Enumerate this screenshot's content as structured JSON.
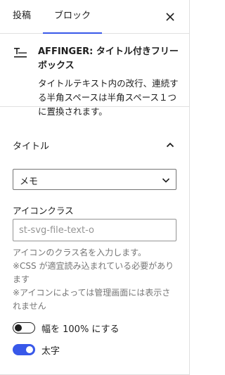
{
  "tabs": [
    {
      "label": "投稿",
      "active": false
    },
    {
      "label": "ブロック",
      "active": true
    }
  ],
  "close_icon": "close-icon",
  "accent_color": "#3858e9",
  "block": {
    "icon": "title-block-icon",
    "title": "AFFINGER: タイトル付きフリーボックス",
    "description": "タイトルテキスト内の改行、連続する半角スペースは半角スペース１つに置換されます。"
  },
  "section": {
    "title": "タイトル",
    "expanded": true,
    "icon": "chevron-up-icon"
  },
  "select": {
    "value": "メモ",
    "icon": "chevron-down-icon"
  },
  "icon_class": {
    "label": "アイコンクラス",
    "placeholder": "st-svg-file-text-o",
    "value": ""
  },
  "help": [
    "アイコンのクラス名を入力します。",
    "※CSS が適宜読み込まれている必要があります",
    "※アイコンによっては管理画面には表示されません"
  ],
  "toggles": [
    {
      "label": "幅を 100% にする",
      "checked": false
    },
    {
      "label": "太字",
      "checked": true
    }
  ]
}
